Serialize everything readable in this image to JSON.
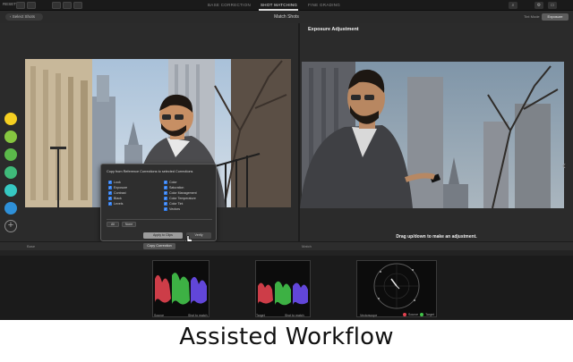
{
  "topbar": {
    "left_label": "RESET",
    "tabs": [
      {
        "label": "BASE CORRECTION",
        "active": false
      },
      {
        "label": "SHOT MATCHING",
        "active": true
      },
      {
        "label": "FINE GRADING",
        "active": false
      }
    ]
  },
  "subbar": {
    "back_label": "‹ Select Shots",
    "title": "Match Shots",
    "right_label": "Tint Mode",
    "right_chip": "Exposure"
  },
  "viewer": {
    "exposure_label": "Exposure Adjustment",
    "drag_hint": "Drag up/down to make an adjustment."
  },
  "swatches": {
    "colors": [
      "#f5cf21",
      "#86c640",
      "#5bb94a",
      "#3fba7a",
      "#36c8c2",
      "#2e90d8"
    ]
  },
  "dialog": {
    "title": "Copy from Reference Corrections to selected Corrections",
    "col1": [
      "Look",
      "Exposure",
      "Contrast",
      "Black",
      "Levels"
    ],
    "col2": [
      "Color",
      "Saturation",
      "Color Management",
      "Color Temperature",
      "Color Tint",
      "Vectors"
    ],
    "all_label": "All",
    "none_label": "None",
    "apply_label": "Apply to Clips",
    "verify_label": "Verify"
  },
  "toolstrip": {
    "left_label": "Base",
    "right_label": "Match",
    "copy_button": "Copy Correction"
  },
  "scopes": {
    "left_caption_a": "Source",
    "left_caption_b": "Shot to match",
    "mid_caption_a": "Target",
    "mid_caption_b": "Shot to match",
    "vs_label": "Vectorscope",
    "vs_source": "Source",
    "vs_target": "Target"
  },
  "caption": "Assisted Workflow"
}
